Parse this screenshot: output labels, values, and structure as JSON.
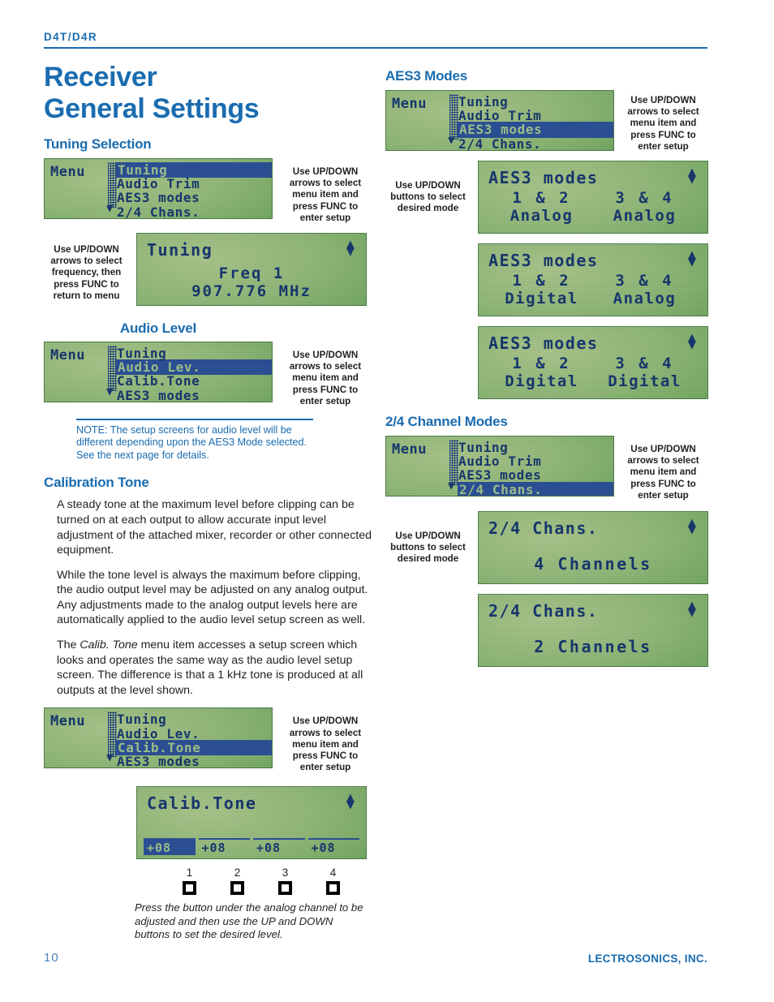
{
  "header": {
    "model": "D4T/D4R"
  },
  "title": {
    "line1": "Receiver",
    "line2": "General Settings"
  },
  "footer": {
    "page_number": "10",
    "brand": "LECTROSONICS, INC."
  },
  "colors": {
    "brand_blue": "#1a6cb0",
    "lcd_green": "#8fb777",
    "lcd_text": "#15366e",
    "lcd_highlight": "#2a4f95"
  },
  "callouts": {
    "select_menu_item": "Use UP/DOWN arrows to select menu item and press FUNC to enter setup",
    "select_frequency": "Use UP/DOWN arrows to select frequency, then press FUNC to return to menu",
    "select_mode": "Use UP/DOWN buttons to select desired mode"
  },
  "sections": {
    "tuning": {
      "heading": "Tuning Selection",
      "menu_lcd": {
        "label": "Menu",
        "rows": [
          "Tuning",
          "Audio Trim",
          "AES3 modes",
          "2/4 Chans."
        ],
        "highlight_index": 0,
        "down_arrow": "▼"
      },
      "setup_lcd": {
        "title": "Tuning",
        "line2": "Freq 1",
        "line3": "907.776 MHz"
      }
    },
    "audio_level": {
      "heading": "Audio Level",
      "menu_lcd": {
        "label": "Menu",
        "rows": [
          "Tuning",
          "Audio Lev.",
          "Calib.Tone",
          "AES3 modes"
        ],
        "highlight_index": 1,
        "down_arrow": "▼"
      },
      "note": "NOTE:  The setup screens for audio level will be different depending upon the AES3 Mode selected. See the next page for details."
    },
    "calibration_tone": {
      "heading": "Calibration Tone",
      "paragraphs": [
        "A steady tone at the maximum level before clipping can be turned on at each output to allow accurate input level adjustment of the attached mixer, recorder or other connected equipment.",
        "While the tone level is always the maximum before clipping, the audio output level may be adjusted on any analog output. Any adjustments made to the analog output levels here are automatically applied to the audio level setup screen as well."
      ],
      "paragraph3": {
        "before": "The ",
        "italic": "Calib. Tone",
        "after": " menu item accesses a setup screen which looks and operates the same way as the audio level setup screen. The difference is that a 1 kHz tone is produced at all outputs at the level shown."
      },
      "menu_lcd": {
        "label": "Menu",
        "rows": [
          "Tuning",
          "Audio Lev.",
          "Calib.Tone",
          "AES3 modes"
        ],
        "highlight_index": 2,
        "down_arrow": "▼"
      },
      "setup_lcd": {
        "title": "Calib.Tone",
        "channel_values": [
          "+08",
          "+08",
          "+08",
          "+08"
        ],
        "selected_channel": 0
      },
      "channel_legend": {
        "numbers": [
          "1",
          "2",
          "3",
          "4"
        ],
        "caption": "Press the button under the analog channel to be adjusted and then use the UP and DOWN buttons to set the desired level."
      }
    },
    "aes3_modes": {
      "heading": "AES3 Modes",
      "menu_lcd": {
        "label": "Menu",
        "rows": [
          "Tuning",
          "Audio Trim",
          "AES3 modes",
          "2/4 Chans."
        ],
        "highlight_index": 2,
        "down_arrow": "▼"
      },
      "mode_screens": [
        {
          "title": "AES3 modes",
          "left_chans": "1 & 2",
          "left_value": "Analog",
          "right_chans": "3 & 4",
          "right_value": "Analog"
        },
        {
          "title": "AES3 modes",
          "left_chans": "1 & 2",
          "left_value": "Digital",
          "right_chans": "3 & 4",
          "right_value": "Analog"
        },
        {
          "title": "AES3 modes",
          "left_chans": "1 & 2",
          "left_value": "Digital",
          "right_chans": "3 & 4",
          "right_value": "Digital"
        }
      ]
    },
    "channel_modes": {
      "heading": "2/4 Channel Modes",
      "menu_lcd": {
        "label": "Menu",
        "rows": [
          "Tuning",
          "Audio Trim",
          "AES3 modes",
          "2/4 Chans."
        ],
        "highlight_index": 3,
        "down_arrow": "▼"
      },
      "mode_screens": [
        {
          "title": "2/4 Chans.",
          "value": "4 Channels"
        },
        {
          "title": "2/4 Chans.",
          "value": "2 Channels"
        }
      ]
    }
  }
}
